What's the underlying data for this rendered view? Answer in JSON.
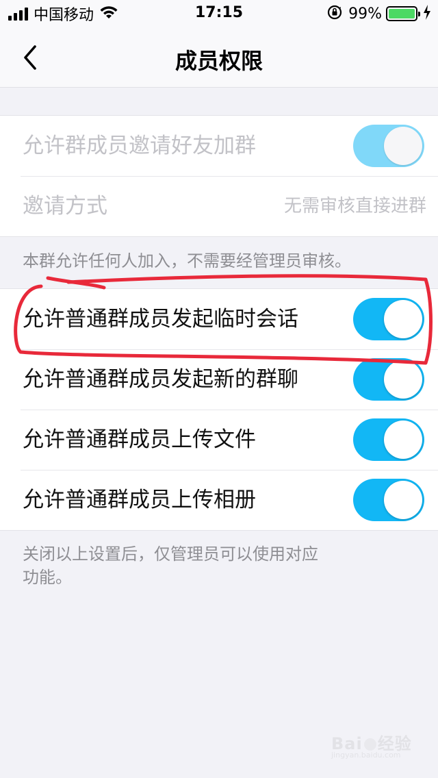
{
  "status_bar": {
    "carrier": "中国移动",
    "time": "17:15",
    "battery_percent": "99%",
    "battery_level": 0.99,
    "icons": [
      "signal-icon",
      "wifi-icon",
      "orientation-lock-icon",
      "battery-icon",
      "charging-bolt-icon"
    ]
  },
  "nav": {
    "title": "成员权限",
    "back_icon": "chevron-left-icon"
  },
  "invite_section": {
    "allow_invite_label": "允许群成员邀请好友加群",
    "allow_invite_on": true,
    "invite_method_label": "邀请方式",
    "invite_method_value": "无需审核直接进群"
  },
  "invite_note": "本群允许任何人加入，不需要经管理员审核。",
  "permissions": [
    {
      "label": "允许普通群成员发起临时会话",
      "on": true
    },
    {
      "label": "允许普通群成员发起新的群聊",
      "on": true
    },
    {
      "label": "允许普通群成员上传文件",
      "on": true
    },
    {
      "label": "允许普通群成员上传相册",
      "on": true
    }
  ],
  "footer_note_line1": "关闭以上设置后，仅管理员可以使用对应",
  "footer_note_line2": "功能。",
  "watermark": {
    "text": "Bai 经验",
    "sub": "jingyan.baidu.com"
  },
  "colors": {
    "toggle_on": "#12b7f5",
    "toggle_disabled": "#80d8f9",
    "annotation_red": "#e8293a",
    "background": "#f2f2f7"
  }
}
